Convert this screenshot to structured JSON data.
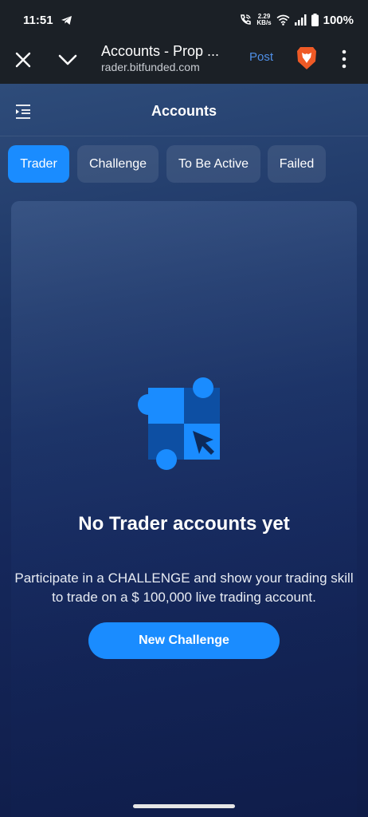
{
  "status_bar": {
    "time": "11:51",
    "net_speed_value": "2.29",
    "net_speed_unit": "KB/s",
    "battery": "100%",
    "icons": [
      "telegram-icon",
      "wifi-call-icon",
      "wifi-icon",
      "signal-icon",
      "battery-icon"
    ]
  },
  "browser": {
    "title": "Accounts - Prop ...",
    "url": "rader.bitfunded.com",
    "post_label": "Post",
    "icons": [
      "close-icon",
      "chevron-down-icon",
      "brave-lion-icon",
      "more-vert-icon"
    ],
    "colors": {
      "bar_bg": "#1b2026",
      "post": "#4f8fe6"
    }
  },
  "app": {
    "title": "Accounts",
    "menu_icon": "menu-indent-icon",
    "tabs": [
      {
        "label": "Trader",
        "active": true
      },
      {
        "label": "Challenge",
        "active": false
      },
      {
        "label": "To Be Active",
        "active": false
      },
      {
        "label": "Failed",
        "active": false
      }
    ],
    "empty_state": {
      "icon": "checker-cursor-illustration-icon",
      "title": "No Trader accounts yet",
      "description": "Participate in a CHALLENGE and show your trading skill to trade on a $ 100,000 live trading account.",
      "button_label": "New Challenge"
    },
    "colors": {
      "accent": "#1a8cff",
      "dark_square": "#0d4fa3"
    }
  }
}
